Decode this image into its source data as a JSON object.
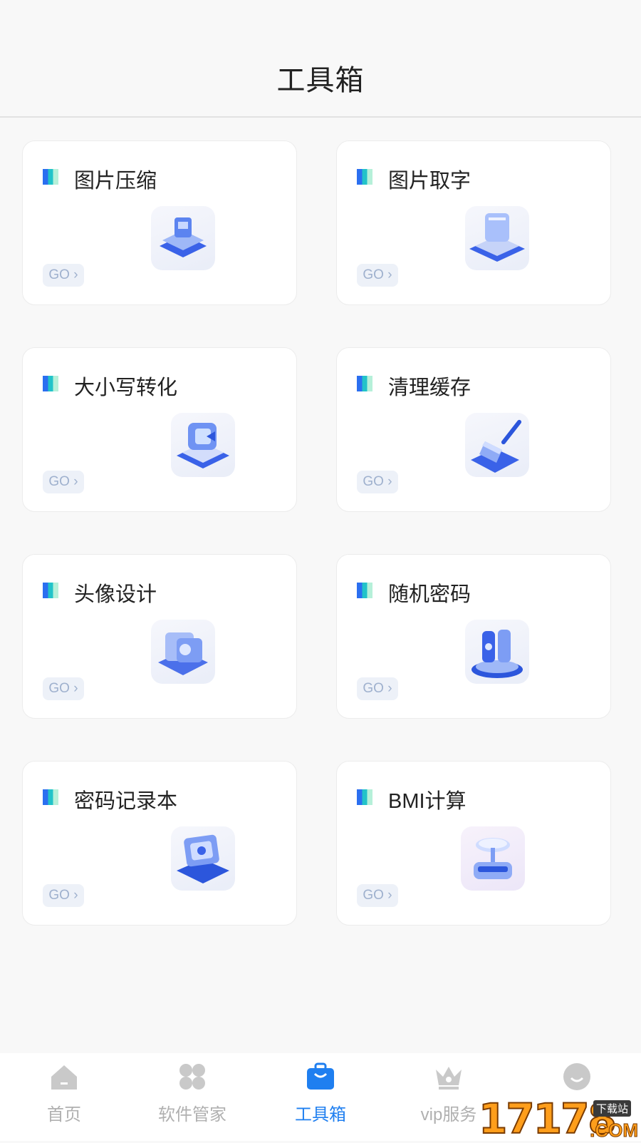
{
  "header": {
    "title": "工具箱"
  },
  "tools": [
    {
      "label": "图片压缩",
      "go": "GO",
      "icon": "image-compress-icon"
    },
    {
      "label": "图片取字",
      "go": "GO",
      "icon": "image-text-extract-icon"
    },
    {
      "label": "大小写转化",
      "go": "GO",
      "icon": "case-convert-icon"
    },
    {
      "label": "清理缓存",
      "go": "GO",
      "icon": "clean-cache-icon"
    },
    {
      "label": "头像设计",
      "go": "GO",
      "icon": "avatar-design-icon"
    },
    {
      "label": "随机密码",
      "go": "GO",
      "icon": "random-password-icon"
    },
    {
      "label": "密码记录本",
      "go": "GO",
      "icon": "password-notebook-icon"
    },
    {
      "label": "BMI计算",
      "go": "GO",
      "icon": "bmi-calculator-icon"
    }
  ],
  "tabbar": {
    "items": [
      {
        "label": "首页",
        "icon": "home-icon"
      },
      {
        "label": "软件管家",
        "icon": "apps-icon"
      },
      {
        "label": "工具箱",
        "icon": "toolbox-icon",
        "active": true
      },
      {
        "label": "vip服务",
        "icon": "crown-icon"
      },
      {
        "label": "",
        "icon": "smile-icon"
      }
    ]
  },
  "watermark": {
    "number": "17178",
    "tag": "下载站",
    "suffix": ".COM"
  },
  "colors": {
    "accent": "#1f7ff0",
    "inactive": "#b0b0b0",
    "go_text": "#9fb1ce"
  }
}
